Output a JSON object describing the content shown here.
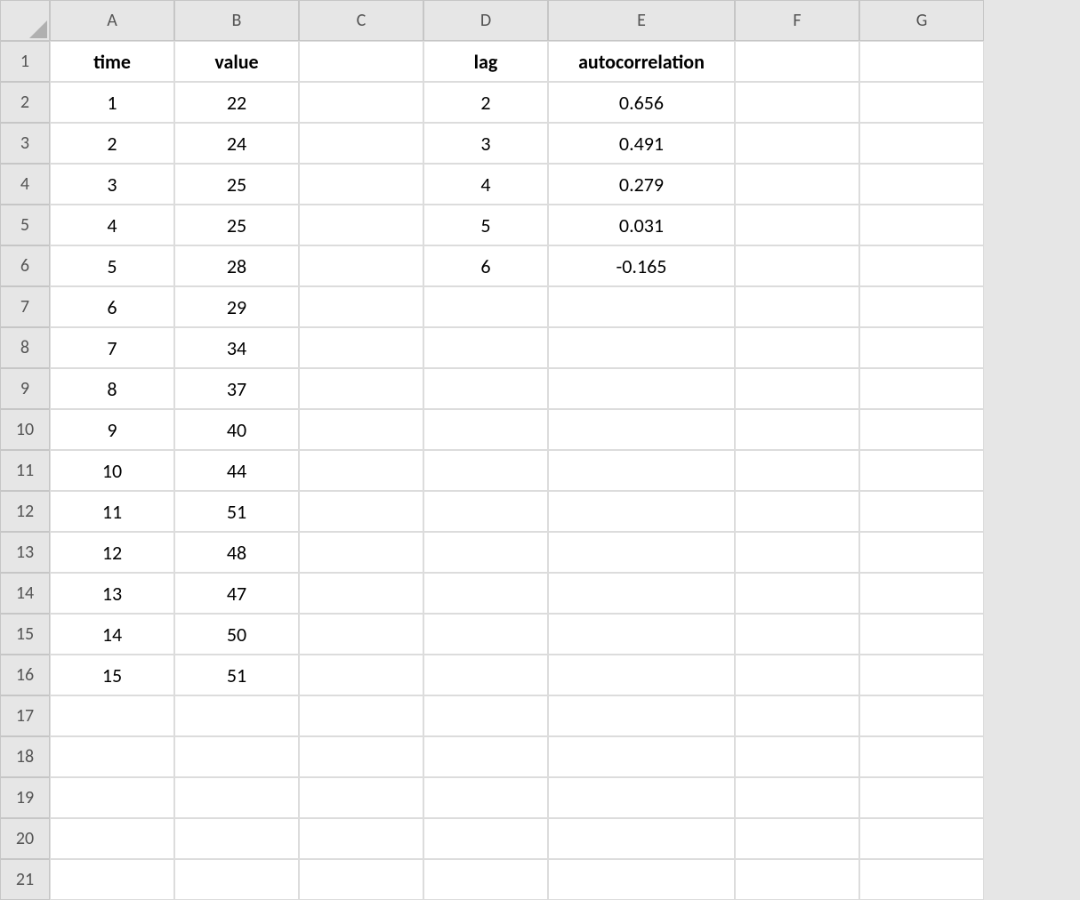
{
  "columns": [
    "A",
    "B",
    "C",
    "D",
    "E",
    "F",
    "G"
  ],
  "rowCount": 21,
  "headers": {
    "A": "time",
    "B": "value",
    "D": "lag",
    "E": "autocorrelation"
  },
  "data": {
    "time": [
      1,
      2,
      3,
      4,
      5,
      6,
      7,
      8,
      9,
      10,
      11,
      12,
      13,
      14,
      15
    ],
    "value": [
      22,
      24,
      25,
      25,
      28,
      29,
      34,
      37,
      40,
      44,
      51,
      48,
      47,
      50,
      51
    ],
    "lag": [
      2,
      3,
      4,
      5,
      6
    ],
    "autocorrelation": [
      0.656,
      0.491,
      0.279,
      0.031,
      -0.165
    ]
  },
  "chart_data": {
    "type": "table",
    "title": "",
    "series": [
      {
        "name": "time",
        "values": [
          1,
          2,
          3,
          4,
          5,
          6,
          7,
          8,
          9,
          10,
          11,
          12,
          13,
          14,
          15
        ]
      },
      {
        "name": "value",
        "values": [
          22,
          24,
          25,
          25,
          28,
          29,
          34,
          37,
          40,
          44,
          51,
          48,
          47,
          50,
          51
        ]
      },
      {
        "name": "lag",
        "values": [
          2,
          3,
          4,
          5,
          6
        ]
      },
      {
        "name": "autocorrelation",
        "values": [
          0.656,
          0.491,
          0.279,
          0.031,
          -0.165
        ]
      }
    ]
  }
}
